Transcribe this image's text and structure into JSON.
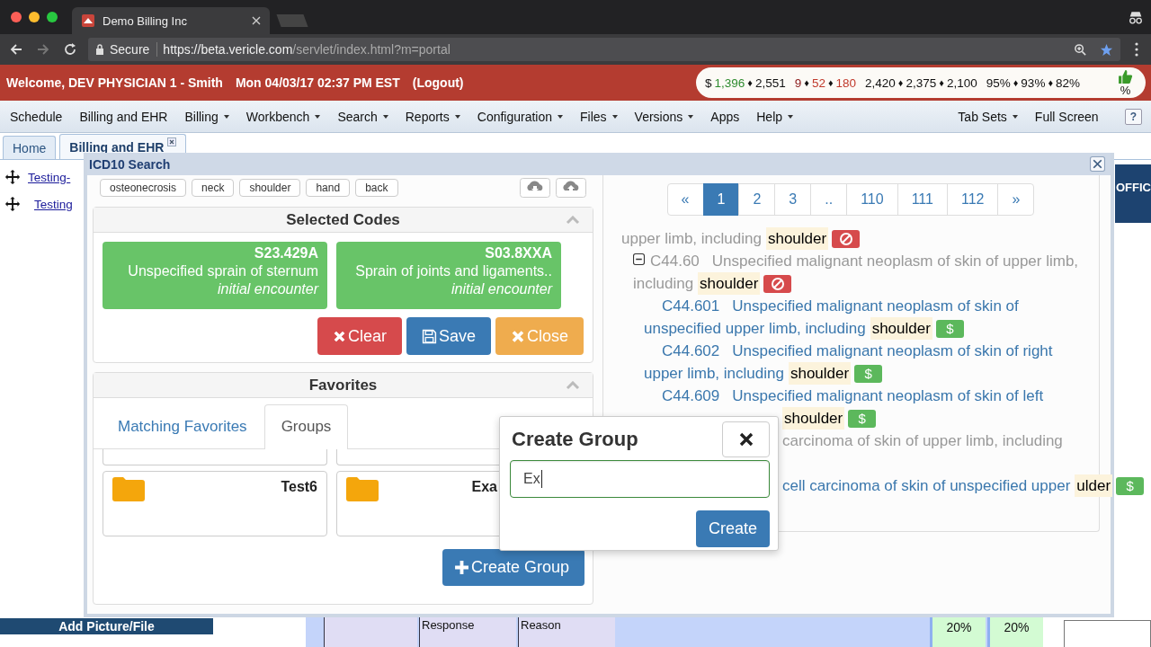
{
  "browser": {
    "tab_title": "Demo Billing Inc",
    "secure_label": "Secure",
    "url_host": "https://beta.vericle.com",
    "url_path": "/servlet/index.html?m=portal"
  },
  "header": {
    "welcome": "Welcome, DEV PHYSICIAN 1 - Smith",
    "datetime": "Mon 04/03/17 02:37 PM EST",
    "logout": "(Logout)",
    "stats": {
      "separator": "♦",
      "unit": "%",
      "groups": [
        [
          {
            "text": "$",
            "color": "#111111"
          },
          {
            "text": "1,396",
            "color": "#2e8b2e"
          },
          {
            "text": "2,551",
            "color": "#111111"
          }
        ],
        [
          {
            "text": "9",
            "color": "#8b1a1a"
          },
          {
            "text": "52",
            "color": "#c0392b"
          },
          {
            "text": "180",
            "color": "#c0392b"
          }
        ],
        [
          {
            "text": "2,420",
            "color": "#111111"
          },
          {
            "text": "2,375",
            "color": "#111111"
          },
          {
            "text": "2,100",
            "color": "#111111"
          }
        ],
        [
          {
            "text": "95%",
            "color": "#111111"
          },
          {
            "text": "93%",
            "color": "#111111"
          },
          {
            "text": "82%",
            "color": "#111111"
          }
        ]
      ]
    }
  },
  "menu": {
    "items": [
      {
        "label": "Schedule",
        "dropdown": false
      },
      {
        "label": "Billing and EHR",
        "dropdown": false
      },
      {
        "label": "Billing",
        "dropdown": true
      },
      {
        "label": "Workbench",
        "dropdown": true
      },
      {
        "label": "Search",
        "dropdown": true
      },
      {
        "label": "Reports",
        "dropdown": true
      },
      {
        "label": "Configuration",
        "dropdown": true
      },
      {
        "label": "Files",
        "dropdown": true
      },
      {
        "label": "Versions",
        "dropdown": true
      },
      {
        "label": "Apps",
        "dropdown": false
      },
      {
        "label": "Help",
        "dropdown": true
      }
    ],
    "right_items": [
      {
        "label": "Tab Sets",
        "dropdown": true
      },
      {
        "label": "Full Screen",
        "dropdown": false
      }
    ],
    "help": "?"
  },
  "tabs": [
    {
      "label": "Home",
      "selected": false,
      "closable": false
    },
    {
      "label": "Billing and EHR",
      "selected": true,
      "closable": true
    }
  ],
  "background": {
    "links": [
      "Testing-",
      "Testing"
    ],
    "office_label": "OFFIC",
    "add_picture": "Add Picture/File",
    "cells": [
      "Response",
      "Reason"
    ],
    "percent_cells": [
      "20%",
      "20%"
    ]
  },
  "dialog": {
    "title": "ICD10 Search",
    "keywords": [
      "osteonecrosis",
      "neck",
      "shoulder",
      "hand",
      "back"
    ],
    "selected_codes": {
      "title": "Selected Codes",
      "codes": [
        {
          "code": "S23.429A",
          "description": "Unspecified sprain of sternum",
          "encounter": "initial encounter"
        },
        {
          "code": "S03.8XXA",
          "description": "Sprain of joints and ligaments..",
          "encounter": "initial encounter"
        }
      ],
      "buttons": [
        {
          "label": "Clear",
          "kind": "danger"
        },
        {
          "label": "Save",
          "kind": "primary"
        },
        {
          "label": "Close",
          "kind": "warning"
        }
      ]
    },
    "favorites": {
      "title": "Favorites",
      "tabs": [
        {
          "label": "Matching Favorites",
          "selected": false
        },
        {
          "label": "Groups",
          "selected": true
        }
      ],
      "groups": [
        {
          "kind": "cut"
        },
        {
          "kind": "cut"
        },
        {
          "kind": "group",
          "name": "Test6",
          "occluded": false
        },
        {
          "kind": "group",
          "name": "Exa",
          "occluded": true
        }
      ],
      "create_button": "Create Group"
    },
    "pagination": [
      {
        "label": "«",
        "selected": false
      },
      {
        "label": "1",
        "selected": true
      },
      {
        "label": "2",
        "selected": false
      },
      {
        "label": "3",
        "selected": false
      },
      {
        "label": "..",
        "selected": false
      },
      {
        "label": "110",
        "selected": false
      },
      {
        "label": "111",
        "selected": false
      },
      {
        "label": "112",
        "selected": false
      },
      {
        "label": "»",
        "selected": false
      }
    ],
    "results": [
      {
        "kind": "excluded",
        "lines": [
          "upper limb, including"
        ],
        "match": "shoulder",
        "occluded": false,
        "children": [
          {
            "kind": "excluded",
            "code": "C44.60",
            "expanded": true,
            "lines": [
              "Unspecified malignant neoplasm of skin of upper limb,",
              "including"
            ],
            "match": "shoulder",
            "occluded": false,
            "children": [
              {
                "kind": "billable",
                "code": "C44.601",
                "lines": [
                  "Unspecified malignant neoplasm of skin of",
                  "unspecified upper limb, including"
                ],
                "match": "shoulder",
                "occluded": false
              },
              {
                "kind": "billable",
                "code": "C44.602",
                "lines": [
                  "Unspecified malignant neoplasm of skin of right",
                  "upper limb, including"
                ],
                "match": "shoulder",
                "occluded": false
              },
              {
                "kind": "billable",
                "code": "C44.609",
                "lines": [
                  "Unspecified malignant neoplasm of skin of left"
                ],
                "match": "shoulder",
                "occluded": true
              }
            ]
          },
          {
            "kind": "parent",
            "lines": [
              "carcinoma of skin of upper limb, including"
            ],
            "occluded": true,
            "children": [
              {
                "kind": "billable",
                "lines": [
                  "cell carcinoma of skin of unspecified upper"
                ],
                "match": "ulder",
                "occluded": true
              }
            ]
          }
        ]
      }
    ],
    "badge_text": "$"
  },
  "popup": {
    "title": "Create Group",
    "value": "Ex",
    "button": "Create"
  }
}
